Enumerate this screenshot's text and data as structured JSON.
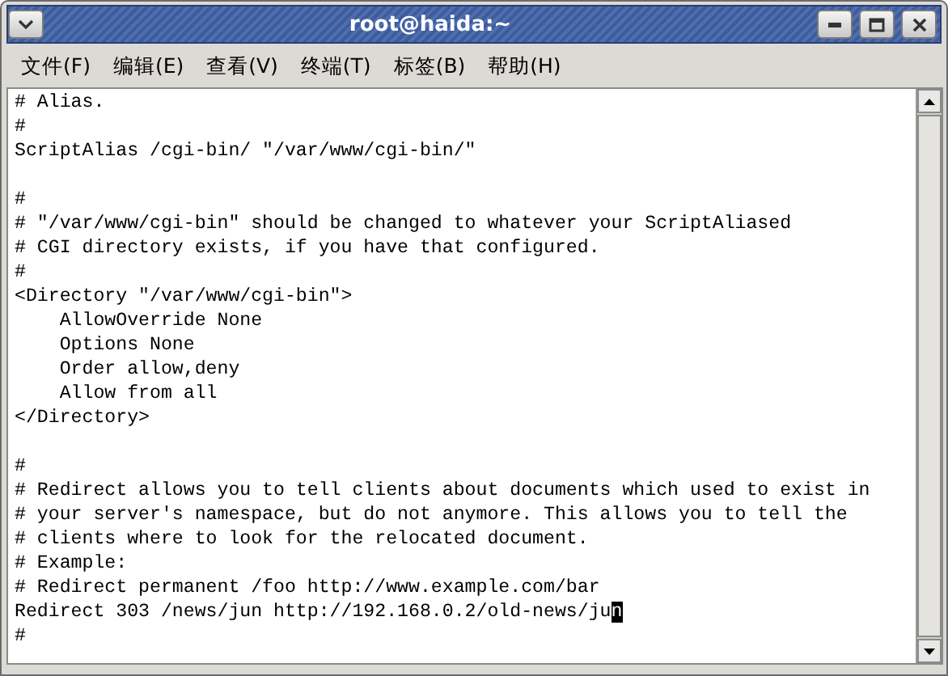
{
  "window": {
    "title": "root@haida:~"
  },
  "menu": [
    "文件(F)",
    "编辑(E)",
    "查看(V)",
    "终端(T)",
    "标签(B)",
    "帮助(H)"
  ],
  "terminal": {
    "lines": [
      {
        "kind": "text",
        "text": "# Alias."
      },
      {
        "kind": "text",
        "text": "#"
      },
      {
        "kind": "text",
        "text": "ScriptAlias /cgi-bin/ \"/var/www/cgi-bin/\""
      },
      {
        "kind": "blank"
      },
      {
        "kind": "text",
        "text": "#"
      },
      {
        "kind": "text",
        "text": "# \"/var/www/cgi-bin\" should be changed to whatever your ScriptAliased"
      },
      {
        "kind": "text",
        "text": "# CGI directory exists, if you have that configured."
      },
      {
        "kind": "text",
        "text": "#"
      },
      {
        "kind": "text",
        "text": "<Directory \"/var/www/cgi-bin\">"
      },
      {
        "kind": "text",
        "text": "    AllowOverride None"
      },
      {
        "kind": "text",
        "text": "    Options None"
      },
      {
        "kind": "text",
        "text": "    Order allow,deny"
      },
      {
        "kind": "text",
        "text": "    Allow from all"
      },
      {
        "kind": "text",
        "text": "</Directory>"
      },
      {
        "kind": "blank"
      },
      {
        "kind": "text",
        "text": "#"
      },
      {
        "kind": "text",
        "text": "# Redirect allows you to tell clients about documents which used to exist in"
      },
      {
        "kind": "text",
        "text": "# your server's namespace, but do not anymore. This allows you to tell the"
      },
      {
        "kind": "text",
        "text": "# clients where to look for the relocated document."
      },
      {
        "kind": "text",
        "text": "# Example:"
      },
      {
        "kind": "text",
        "text": "# Redirect permanent /foo http://www.example.com/bar"
      },
      {
        "kind": "cursor",
        "text": "Redirect 303 /news/jun http://192.168.0.2/old-news/ju",
        "cursor": "n"
      },
      {
        "kind": "text",
        "text": "#"
      }
    ]
  }
}
